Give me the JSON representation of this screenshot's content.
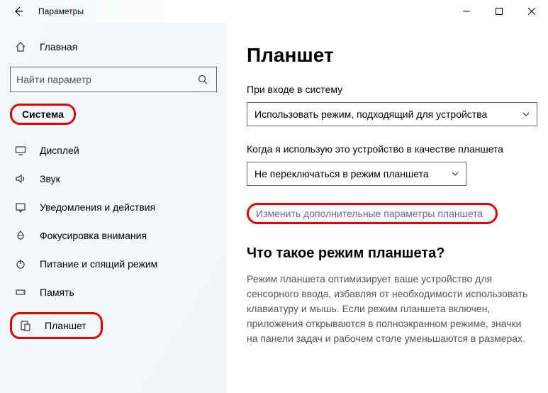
{
  "window": {
    "title": "Параметры"
  },
  "sidebar": {
    "home_label": "Главная",
    "search_placeholder": "Найти параметр",
    "group_label": "Система",
    "items": [
      {
        "label": "Дисплей"
      },
      {
        "label": "Звук"
      },
      {
        "label": "Уведомления и действия"
      },
      {
        "label": "Фокусировка внимания"
      },
      {
        "label": "Питание и спящий режим"
      },
      {
        "label": "Память"
      },
      {
        "label": "Планшет"
      }
    ]
  },
  "main": {
    "heading": "Планшет",
    "signin_label": "При входе в систему",
    "signin_value": "Использовать режим, подходящий для устройства",
    "usage_label": "Когда я использую это устройство в качестве планшета",
    "usage_value": "Не переключаться в режим планшета",
    "link_text": "Изменить дополнительные параметры планшета",
    "section_heading": "Что такое режим планшета?",
    "section_body": "Режим планшета оптимизирует ваше устройство для сенсорного ввода, избавляя от необходимости использовать клавиатуру и мышь. Если режим планшета включен, приложения открываются в полноэкранном режиме, значки на панели задач и рабочем столе уменьшаются в размерах."
  }
}
